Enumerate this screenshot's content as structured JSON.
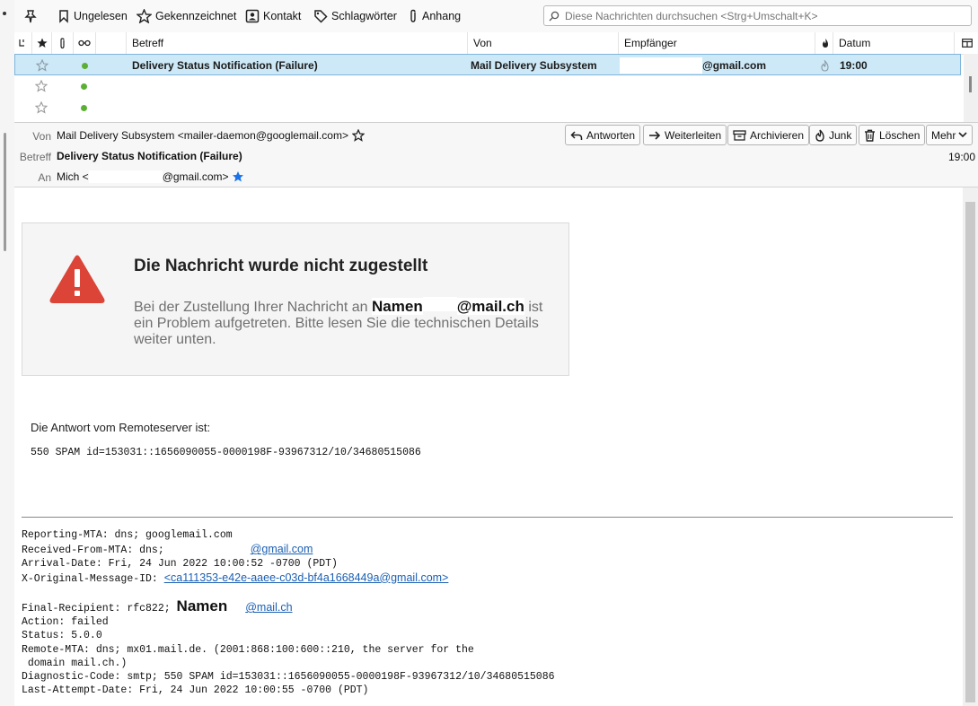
{
  "quickfilter": {
    "unread": "Ungelesen",
    "starred": "Gekennzeichnet",
    "contact": "Kontakt",
    "tags": "Schlagwörter",
    "attachment": "Anhang",
    "search_placeholder": "Diese Nachrichten durchsuchen <Strg+Umschalt+K>"
  },
  "columns": {
    "subject": "Betreff",
    "from": "Von",
    "recipient": "Empfänger",
    "date": "Datum"
  },
  "messages": [
    {
      "subject": "Delivery Status Notification (Failure)",
      "from": "Mail Delivery Subsystem",
      "recipient": "@gmail.com",
      "date": "19:00"
    }
  ],
  "header": {
    "from_label": "Von",
    "from_value": "Mail Delivery Subsystem <mailer-daemon@googlemail.com>",
    "subject_label": "Betreff",
    "subject_value": "Delivery Status Notification (Failure)",
    "to_label": "An",
    "to_prefix": "Mich <",
    "to_suffix": "@gmail.com>",
    "time": "19:00",
    "buttons": {
      "reply": "Antworten",
      "forward": "Weiterleiten",
      "archive": "Archivieren",
      "junk": "Junk",
      "delete": "Löschen",
      "more": "Mehr"
    }
  },
  "body": {
    "card_title": "Die Nachricht wurde nicht zugestellt",
    "card_text_1": "Bei der Zustellung Ihrer Nachricht an",
    "card_name": "Namen",
    "card_domain": "@mail.ch",
    "card_text_2": "ist ein Problem aufgetreten. Bitte lesen Sie die technischen Details weiter unten.",
    "remote_label": "Die Antwort vom Remoteserver ist:",
    "spam_line": "550 SPAM id=153031::1656090055-0000198F-93967312/10/34680515086",
    "report": {
      "reporting_mta": "Reporting-MTA: dns; googlemail.com",
      "received_from": "Received-From-MTA: dns;",
      "received_link": "@gmail.com",
      "arrival": "Arrival-Date: Fri, 24 Jun 2022 10:00:52 -0700 (PDT)",
      "orig_id_label": "X-Original-Message-ID:",
      "orig_id_link": "<ca111353-e42e-aaee-c03d-bf4a1668449a@gmail.com>",
      "final_label": "Final-Recipient: rfc822;",
      "final_name": "Namen",
      "final_link": "@mail.ch",
      "action": "Action: failed",
      "status": "Status: 5.0.0",
      "remote_mta": "Remote-MTA: dns; mx01.mail.de. (2001:868:100:600::210, the server for the",
      "remote_mta_2": " domain mail.ch.)",
      "diagnostic": "Diagnostic-Code: smtp; 550 SPAM id=153031::1656090055-0000198F-93967312/10/34680515086",
      "last_attempt": "Last-Attempt-Date: Fri, 24 Jun 2022 10:00:55 -0700 (PDT)"
    }
  }
}
